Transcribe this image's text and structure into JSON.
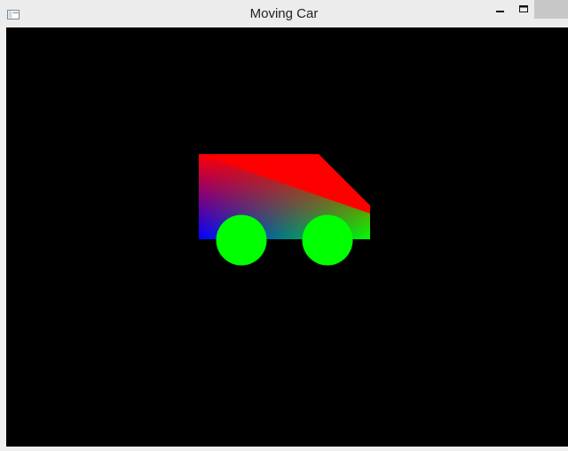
{
  "window": {
    "title": "Moving Car",
    "controls": {
      "minimize_icon": "minimize-icon",
      "maximize_icon": "maximize-icon",
      "close_icon": "close-icon"
    },
    "app_icon": "window-app-icon"
  },
  "scene": {
    "background": "#000000",
    "car": {
      "body_colors": {
        "top": "#ff0000",
        "bottom_left": "#0000ff",
        "bottom_right": "#00ff00"
      },
      "wheel_color": "#00ff00"
    }
  }
}
